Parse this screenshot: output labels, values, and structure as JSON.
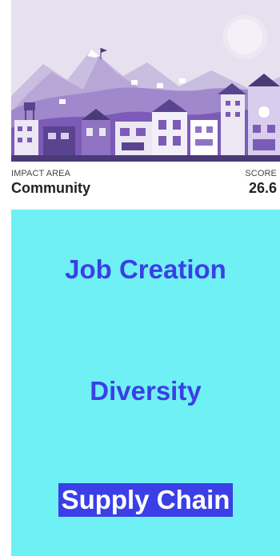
{
  "impact": {
    "area_label": "IMPACT AREA",
    "area_value": "Community",
    "score_label": "SCORE",
    "score_value": "26.6"
  },
  "topics": [
    {
      "label": "Job Creation",
      "active": false
    },
    {
      "label": "Diversity",
      "active": false
    },
    {
      "label": "Supply Chain",
      "active": true
    }
  ],
  "colors": {
    "topic_background": "#6ff0f4",
    "topic_text": "#3a3fe6",
    "active_highlight": "#3a3fe6",
    "illustration_sky": "#e6e0ee",
    "illustration_purple": "#7c5bb8"
  }
}
